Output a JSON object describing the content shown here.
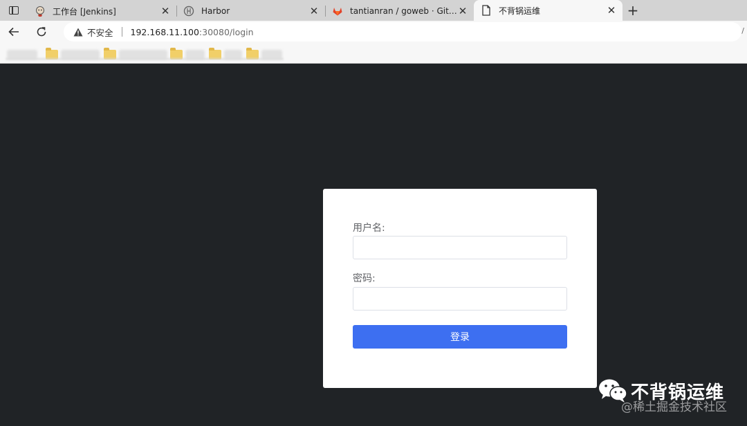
{
  "tabs": [
    {
      "title": "工作台 [Jenkins]",
      "favicon": "jenkins-icon"
    },
    {
      "title": "Harbor",
      "favicon": "harbor-icon"
    },
    {
      "title": "tantianran / goweb · GitLab",
      "favicon": "gitlab-icon"
    },
    {
      "title": "不背锅运维",
      "favicon": "page-icon",
      "active": true
    }
  ],
  "omnibox": {
    "security_label": "不安全",
    "url_host": "192.168.11.100",
    "url_path": ":30080/login"
  },
  "toolbar_end": "/",
  "login": {
    "username_label": "用户名:",
    "username_value": "",
    "password_label": "密码:",
    "password_value": "",
    "submit_label": "登录"
  },
  "watermark": {
    "title": "不背锅运维",
    "subtitle": "@稀土掘金技术社区"
  },
  "colors": {
    "page_background": "#202326",
    "button": "#3d6ff1",
    "tabstrip": "#d3d3d3"
  }
}
